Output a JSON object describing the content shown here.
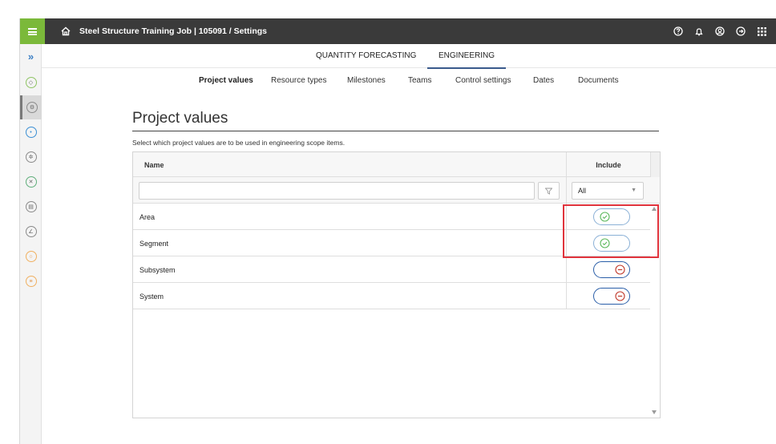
{
  "header": {
    "breadcrumb": "Steel Structure Training Job | 105091  /  Settings",
    "icons": [
      "menu-icon",
      "home-icon",
      "help-icon",
      "bell-icon",
      "user-icon",
      "logout-icon",
      "apps-grid-icon"
    ],
    "accent_color": "#7bb93a",
    "bar_color": "#3a3a3a"
  },
  "rail": {
    "expand_glyph": "»",
    "icons": [
      "box-icon",
      "tools-icon",
      "target-icon",
      "gear-icon",
      "cube-icon",
      "document-icon",
      "chart-icon",
      "search-icon",
      "list-icon"
    ]
  },
  "main_tabs": [
    {
      "label": "QUANTITY FORECASTING",
      "active": false
    },
    {
      "label": "ENGINEERING",
      "active": true
    }
  ],
  "sub_tabs": [
    {
      "label": "Project values",
      "active": true
    },
    {
      "label": "Resource types",
      "active": false
    },
    {
      "label": "Milestones",
      "active": false
    },
    {
      "label": "Teams",
      "active": false
    },
    {
      "label": "Control settings",
      "active": false
    },
    {
      "label": "Dates",
      "active": false
    },
    {
      "label": "Documents",
      "active": false
    }
  ],
  "content": {
    "title": "Project values",
    "description": "Select which project values are to be used in engineering scope items."
  },
  "grid": {
    "columns": {
      "name": "Name",
      "include": "Include"
    },
    "filter": {
      "name_value": "",
      "include_value": "All"
    },
    "rows": [
      {
        "name": "Area",
        "include": true
      },
      {
        "name": "Segment",
        "include": true
      },
      {
        "name": "Subsystem",
        "include": false
      },
      {
        "name": "System",
        "include": false
      }
    ],
    "on_color": "#5cb85c",
    "off_color": "#c0392b",
    "highlight_color": "#e0333c"
  }
}
